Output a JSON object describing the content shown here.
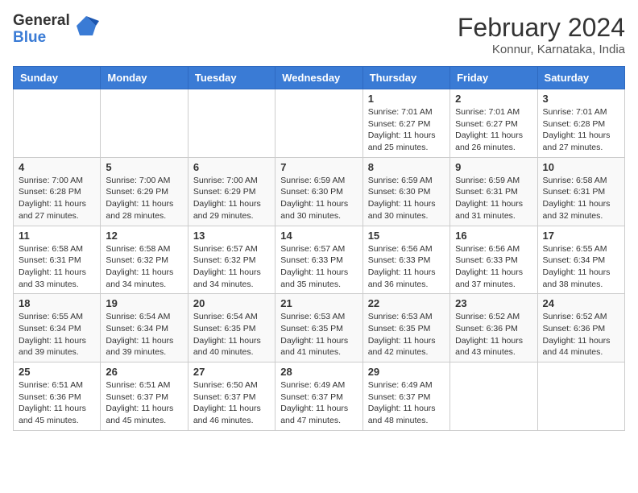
{
  "logo": {
    "general": "General",
    "blue": "Blue"
  },
  "title": "February 2024",
  "subtitle": "Konnur, Karnataka, India",
  "days_of_week": [
    "Sunday",
    "Monday",
    "Tuesday",
    "Wednesday",
    "Thursday",
    "Friday",
    "Saturday"
  ],
  "weeks": [
    [
      {
        "day": "",
        "info": ""
      },
      {
        "day": "",
        "info": ""
      },
      {
        "day": "",
        "info": ""
      },
      {
        "day": "",
        "info": ""
      },
      {
        "day": "1",
        "info": "Sunrise: 7:01 AM\nSunset: 6:27 PM\nDaylight: 11 hours and 25 minutes."
      },
      {
        "day": "2",
        "info": "Sunrise: 7:01 AM\nSunset: 6:27 PM\nDaylight: 11 hours and 26 minutes."
      },
      {
        "day": "3",
        "info": "Sunrise: 7:01 AM\nSunset: 6:28 PM\nDaylight: 11 hours and 27 minutes."
      }
    ],
    [
      {
        "day": "4",
        "info": "Sunrise: 7:00 AM\nSunset: 6:28 PM\nDaylight: 11 hours and 27 minutes."
      },
      {
        "day": "5",
        "info": "Sunrise: 7:00 AM\nSunset: 6:29 PM\nDaylight: 11 hours and 28 minutes."
      },
      {
        "day": "6",
        "info": "Sunrise: 7:00 AM\nSunset: 6:29 PM\nDaylight: 11 hours and 29 minutes."
      },
      {
        "day": "7",
        "info": "Sunrise: 6:59 AM\nSunset: 6:30 PM\nDaylight: 11 hours and 30 minutes."
      },
      {
        "day": "8",
        "info": "Sunrise: 6:59 AM\nSunset: 6:30 PM\nDaylight: 11 hours and 30 minutes."
      },
      {
        "day": "9",
        "info": "Sunrise: 6:59 AM\nSunset: 6:31 PM\nDaylight: 11 hours and 31 minutes."
      },
      {
        "day": "10",
        "info": "Sunrise: 6:58 AM\nSunset: 6:31 PM\nDaylight: 11 hours and 32 minutes."
      }
    ],
    [
      {
        "day": "11",
        "info": "Sunrise: 6:58 AM\nSunset: 6:31 PM\nDaylight: 11 hours and 33 minutes."
      },
      {
        "day": "12",
        "info": "Sunrise: 6:58 AM\nSunset: 6:32 PM\nDaylight: 11 hours and 34 minutes."
      },
      {
        "day": "13",
        "info": "Sunrise: 6:57 AM\nSunset: 6:32 PM\nDaylight: 11 hours and 34 minutes."
      },
      {
        "day": "14",
        "info": "Sunrise: 6:57 AM\nSunset: 6:33 PM\nDaylight: 11 hours and 35 minutes."
      },
      {
        "day": "15",
        "info": "Sunrise: 6:56 AM\nSunset: 6:33 PM\nDaylight: 11 hours and 36 minutes."
      },
      {
        "day": "16",
        "info": "Sunrise: 6:56 AM\nSunset: 6:33 PM\nDaylight: 11 hours and 37 minutes."
      },
      {
        "day": "17",
        "info": "Sunrise: 6:55 AM\nSunset: 6:34 PM\nDaylight: 11 hours and 38 minutes."
      }
    ],
    [
      {
        "day": "18",
        "info": "Sunrise: 6:55 AM\nSunset: 6:34 PM\nDaylight: 11 hours and 39 minutes."
      },
      {
        "day": "19",
        "info": "Sunrise: 6:54 AM\nSunset: 6:34 PM\nDaylight: 11 hours and 39 minutes."
      },
      {
        "day": "20",
        "info": "Sunrise: 6:54 AM\nSunset: 6:35 PM\nDaylight: 11 hours and 40 minutes."
      },
      {
        "day": "21",
        "info": "Sunrise: 6:53 AM\nSunset: 6:35 PM\nDaylight: 11 hours and 41 minutes."
      },
      {
        "day": "22",
        "info": "Sunrise: 6:53 AM\nSunset: 6:35 PM\nDaylight: 11 hours and 42 minutes."
      },
      {
        "day": "23",
        "info": "Sunrise: 6:52 AM\nSunset: 6:36 PM\nDaylight: 11 hours and 43 minutes."
      },
      {
        "day": "24",
        "info": "Sunrise: 6:52 AM\nSunset: 6:36 PM\nDaylight: 11 hours and 44 minutes."
      }
    ],
    [
      {
        "day": "25",
        "info": "Sunrise: 6:51 AM\nSunset: 6:36 PM\nDaylight: 11 hours and 45 minutes."
      },
      {
        "day": "26",
        "info": "Sunrise: 6:51 AM\nSunset: 6:37 PM\nDaylight: 11 hours and 45 minutes."
      },
      {
        "day": "27",
        "info": "Sunrise: 6:50 AM\nSunset: 6:37 PM\nDaylight: 11 hours and 46 minutes."
      },
      {
        "day": "28",
        "info": "Sunrise: 6:49 AM\nSunset: 6:37 PM\nDaylight: 11 hours and 47 minutes."
      },
      {
        "day": "29",
        "info": "Sunrise: 6:49 AM\nSunset: 6:37 PM\nDaylight: 11 hours and 48 minutes."
      },
      {
        "day": "",
        "info": ""
      },
      {
        "day": "",
        "info": ""
      }
    ]
  ]
}
